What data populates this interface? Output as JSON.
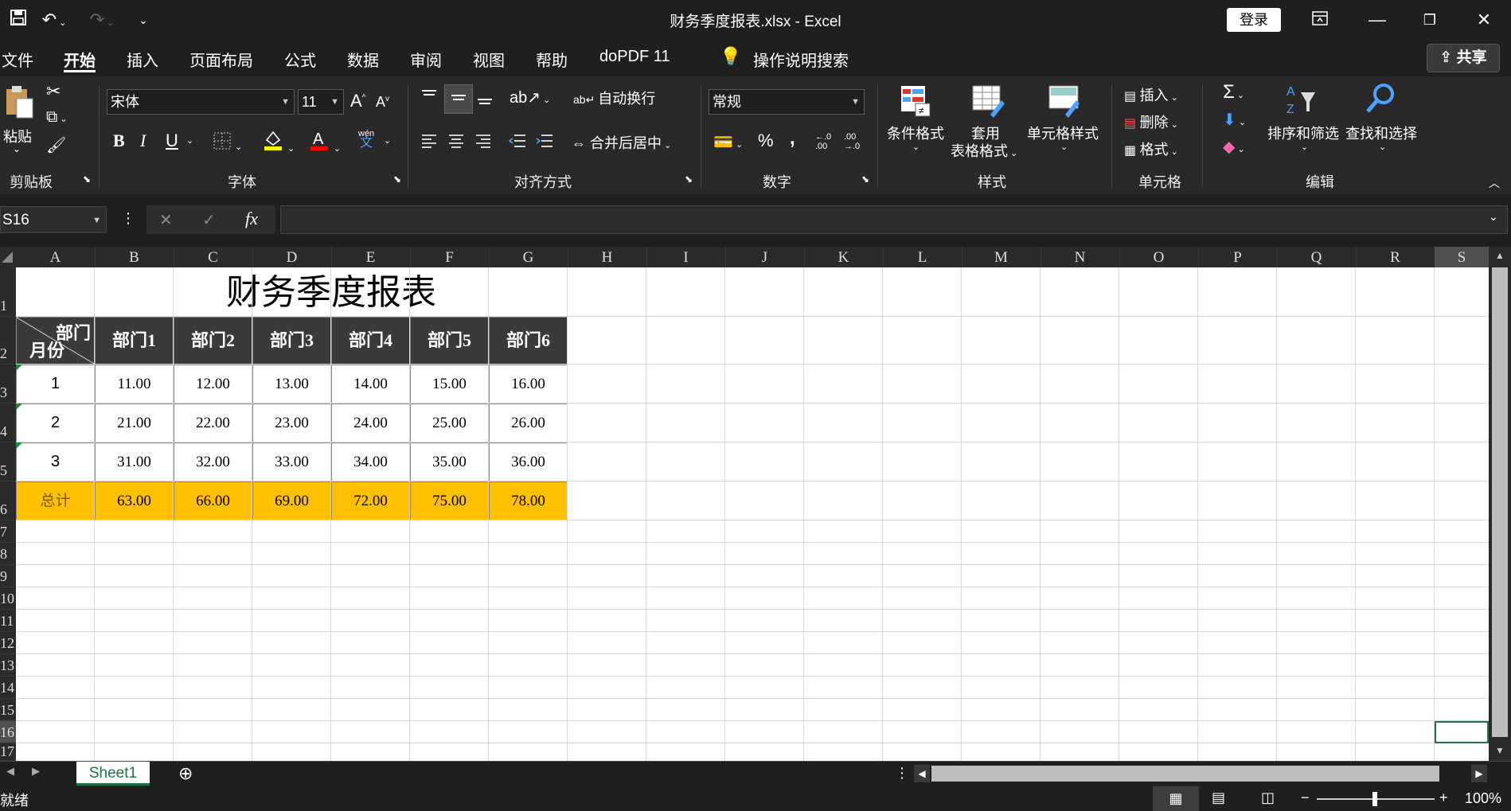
{
  "window": {
    "title": "财务季度报表.xlsx  -  Excel",
    "login_label": "登录"
  },
  "menu": {
    "tabs": [
      "文件",
      "开始",
      "插入",
      "页面布局",
      "公式",
      "数据",
      "审阅",
      "视图",
      "帮助",
      "doPDF 11"
    ],
    "active_tab": "开始",
    "tell_me": "操作说明搜索",
    "share_label": "共享"
  },
  "ribbon": {
    "clipboard": {
      "paste_label": "粘贴",
      "group_label": "剪贴板"
    },
    "font": {
      "font_name": "宋体",
      "font_size": "11",
      "bold": "B",
      "italic": "I",
      "underline": "U",
      "group_label": "字体",
      "phonetic": "wén"
    },
    "alignment": {
      "wrap_label": "自动换行",
      "merge_label": "合并后居中",
      "group_label": "对齐方式"
    },
    "number": {
      "format": "常规",
      "percent": "%",
      "comma": ",",
      "inc_decimal": "←.0 .00",
      "dec_decimal": ".00 →.0",
      "group_label": "数字"
    },
    "styles": {
      "conditional_label": "条件格式",
      "table_label_1": "套用",
      "table_label_2": "表格格式",
      "cell_styles_label": "单元格样式",
      "group_label": "样式"
    },
    "cells": {
      "insert_label": "插入",
      "delete_label": "删除",
      "format_label": "格式",
      "group_label": "单元格"
    },
    "editing": {
      "sort_label": "排序和筛选",
      "find_label": "查找和选择",
      "group_label": "编辑"
    }
  },
  "formula_bar": {
    "name_box": "S16",
    "cancel": "✕",
    "enter": "✓",
    "fx": "fx",
    "content": ""
  },
  "sheet": {
    "columns": [
      "A",
      "B",
      "C",
      "D",
      "E",
      "F",
      "G",
      "H",
      "I",
      "J",
      "K",
      "L",
      "M",
      "N",
      "O",
      "P",
      "Q",
      "R",
      "S"
    ],
    "rows": [
      "1",
      "2",
      "3",
      "4",
      "5",
      "6",
      "7",
      "8",
      "9",
      "10",
      "11",
      "12",
      "13",
      "14",
      "15",
      "16",
      "17"
    ],
    "title": "财务季度报表",
    "corner_top": "部门",
    "corner_bottom": "月份",
    "headers": [
      "部门1",
      "部门2",
      "部门3",
      "部门4",
      "部门5",
      "部门6"
    ],
    "data": [
      {
        "month": "1",
        "values": [
          "11.00",
          "12.00",
          "13.00",
          "14.00",
          "15.00",
          "16.00"
        ]
      },
      {
        "month": "2",
        "values": [
          "21.00",
          "22.00",
          "23.00",
          "24.00",
          "25.00",
          "26.00"
        ]
      },
      {
        "month": "3",
        "values": [
          "31.00",
          "32.00",
          "33.00",
          "34.00",
          "35.00",
          "36.00"
        ]
      }
    ],
    "total": {
      "label": "总计",
      "values": [
        "63.00",
        "66.00",
        "69.00",
        "72.00",
        "75.00",
        "78.00"
      ]
    },
    "total_color": "#ffc000",
    "header_color": "#3a3a3a"
  },
  "tabs": {
    "sheet_name": "Sheet1"
  },
  "status": {
    "ready": "就绪",
    "zoom": "100%"
  }
}
